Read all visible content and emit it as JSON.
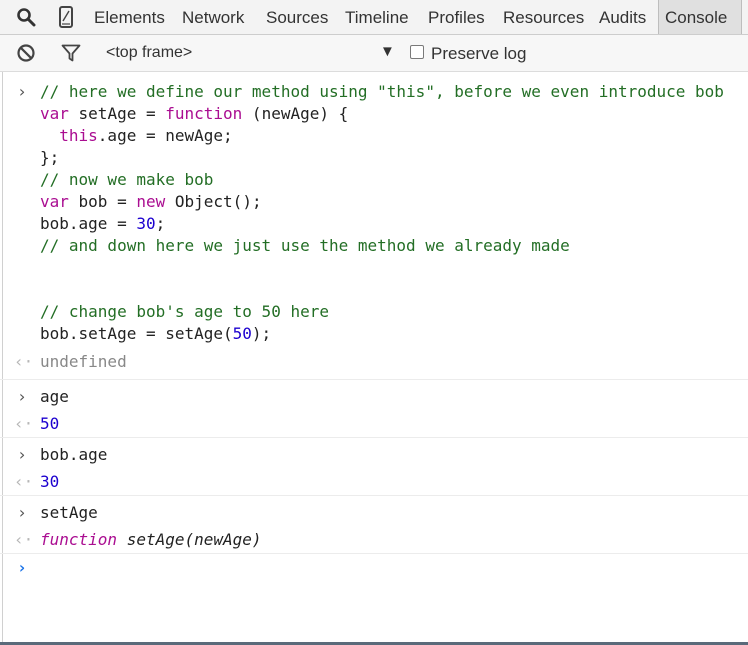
{
  "toolbar": {
    "tabs": [
      "Elements",
      "Network",
      "Sources",
      "Timeline",
      "Profiles",
      "Resources",
      "Audits",
      "Console"
    ],
    "selected_tab": "Console",
    "icons": [
      "search-icon",
      "device-mode-icon"
    ]
  },
  "console_toolbar": {
    "icons": [
      "clear-console-icon",
      "filter-icon"
    ],
    "frame": "<top frame>",
    "preserve_log": "Preserve log",
    "preserve_log_checked": false
  },
  "console": {
    "entry1": {
      "code_lines": [
        "// here we define our method using \"this\", before we even introduce bob",
        "var setAge = function (newAge) {",
        "  this.age = newAge;",
        "};",
        "// now we make bob",
        "var bob = new Object();",
        "bob.age = 30;",
        "// and down here we just use the method we already made",
        "",
        "",
        "// change bob's age to 50 here",
        "bob.setAge = setAge(50);"
      ],
      "result": "undefined"
    },
    "entry2": {
      "input": "age",
      "result": "50"
    },
    "entry3": {
      "input": "bob.age",
      "result": "30"
    },
    "entry4": {
      "input": "setAge",
      "result_keyword": "function",
      "result_signature": "setAge(newAge)"
    }
  },
  "colors": {
    "comment": "#236e25",
    "keyword": "#aa0d91",
    "number": "#1c00cf",
    "prompt_active": "#1a73e8"
  }
}
